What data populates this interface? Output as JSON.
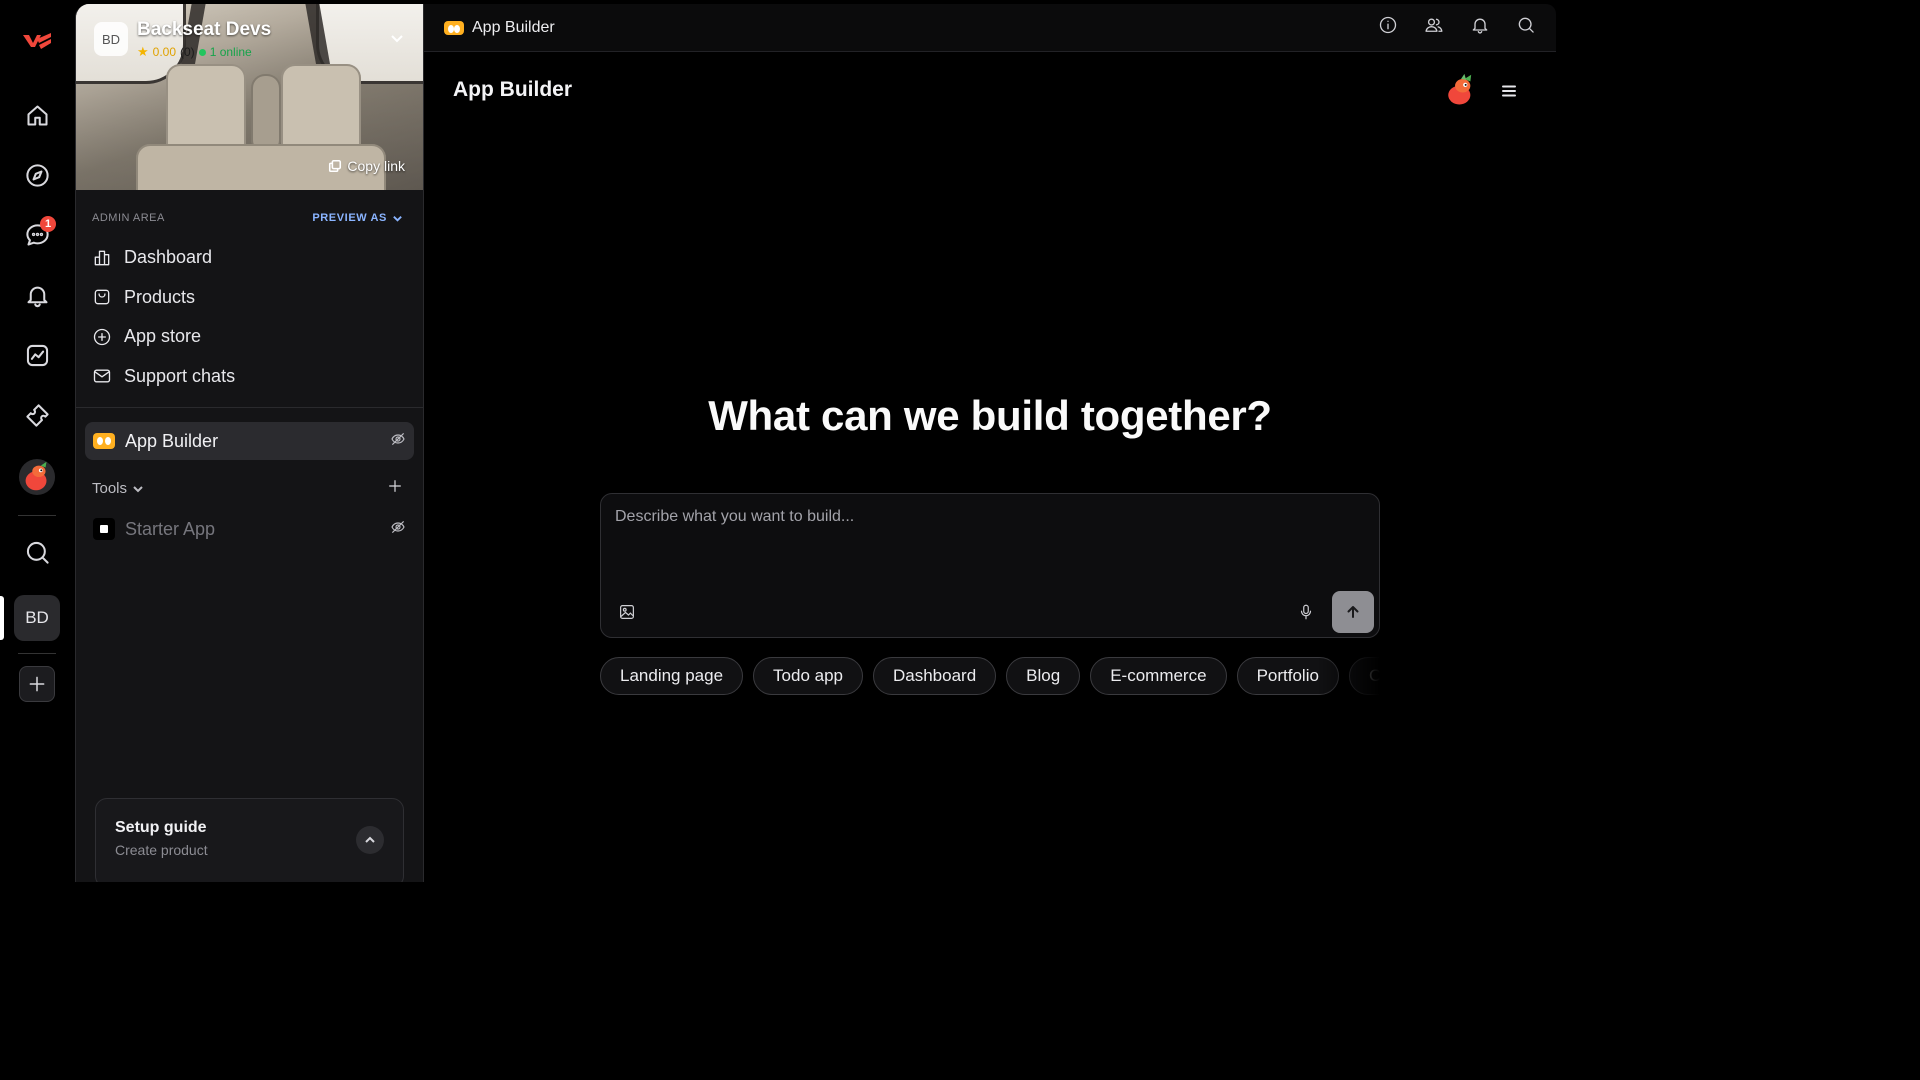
{
  "rail": {
    "badge_count": "1",
    "workspace_initials": "BD"
  },
  "workspace": {
    "initials": "BD",
    "name": "Backseat Devs",
    "rating": "0.00",
    "rating_count": "(0)",
    "online": "1 online",
    "copy_link": "Copy link"
  },
  "admin": {
    "label": "ADMIN AREA",
    "preview_as": "PREVIEW AS"
  },
  "nav": {
    "items": [
      {
        "label": "Dashboard",
        "icon": "bar-chart-icon"
      },
      {
        "label": "Products",
        "icon": "bag-icon"
      },
      {
        "label": "App store",
        "icon": "plus-circle-icon"
      },
      {
        "label": "Support chats",
        "icon": "mail-icon"
      }
    ]
  },
  "apps": {
    "app_builder": "App Builder",
    "tools_label": "Tools",
    "starter_app": "Starter App"
  },
  "setup": {
    "title": "Setup guide",
    "subtitle": "Create product"
  },
  "topbar": {
    "title": "App Builder"
  },
  "main": {
    "page_title": "App Builder",
    "hero": "What can we build together?",
    "prompt_placeholder": "Describe what you want to build...",
    "chips": [
      "Landing page",
      "Todo app",
      "Dashboard",
      "Blog",
      "E-commerce",
      "Portfolio",
      "C"
    ]
  },
  "colors": {
    "accent": "#f0473b",
    "preview_link": "#8ab4ff",
    "app_icon": "#ffb020",
    "online": "#22c55e"
  }
}
